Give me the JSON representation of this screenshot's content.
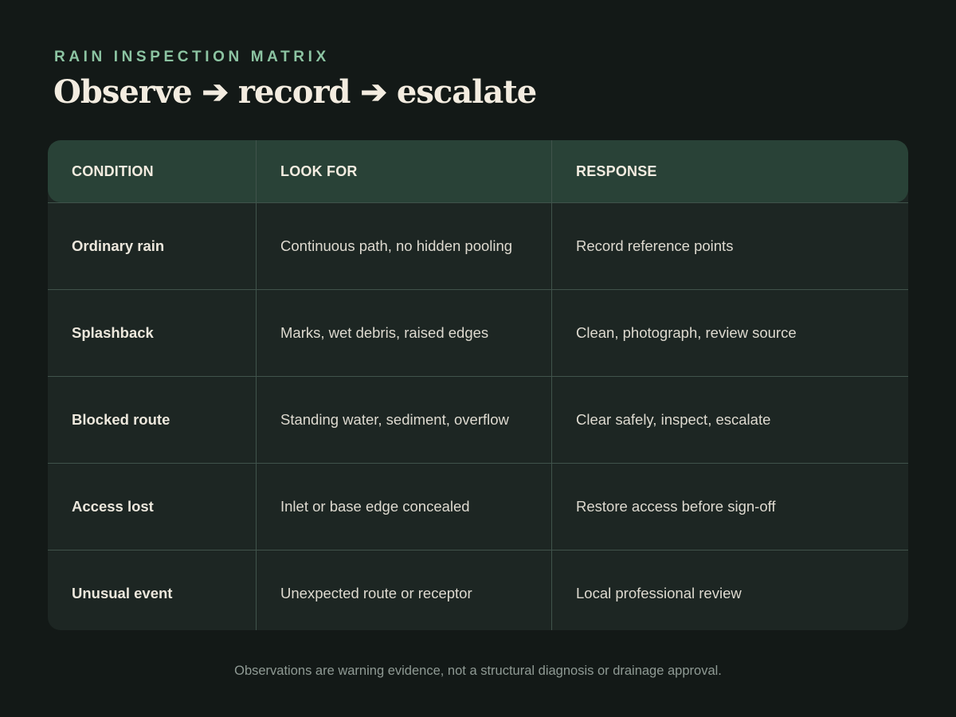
{
  "header": {
    "eyebrow": "RAIN INSPECTION MATRIX",
    "title": "Observe ➔ record ➔ escalate"
  },
  "table": {
    "columns": [
      "CONDITION",
      "LOOK FOR",
      "RESPONSE"
    ],
    "rows": [
      [
        "Ordinary rain",
        "Continuous path, no hidden pooling",
        "Record reference points"
      ],
      [
        "Splashback",
        "Marks, wet debris, raised edges",
        "Clean, photograph, review source"
      ],
      [
        "Blocked route",
        "Standing water, sediment, overflow",
        "Clear safely, inspect, escalate"
      ],
      [
        "Access lost",
        "Inlet or base edge concealed",
        "Restore access before sign-off"
      ],
      [
        "Unusual event",
        "Unexpected route or receptor",
        "Local professional review"
      ]
    ]
  },
  "footnote": "Observations are warning evidence, not a structural diagnosis or drainage approval."
}
